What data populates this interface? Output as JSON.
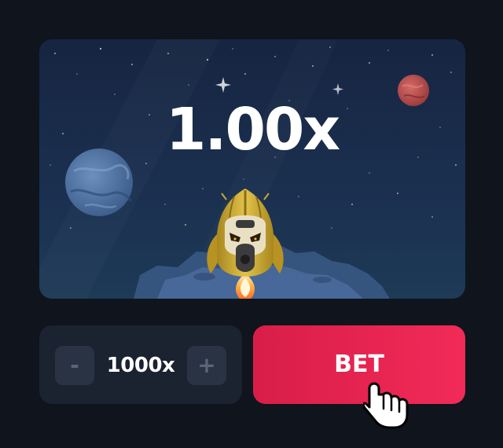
{
  "game": {
    "multiplier": "1.00x"
  },
  "controls": {
    "decrement_label": "-",
    "amount": "1000x",
    "increment_label": "+"
  },
  "bet": {
    "label": "BET"
  },
  "colors": {
    "background": "#0f141d",
    "stage_top": "#162541",
    "stage_bottom": "#1d3a57",
    "glow": "#1fb5a8",
    "rocket_gold": "#c9a532",
    "bet_button": "#ee2757",
    "control_panel": "#1b2230",
    "step_button": "#2a3343"
  },
  "icons": {
    "rocket": "rocket-icon",
    "cursor": "hand-pointer-icon",
    "planet_left": "blue-planet-icon",
    "planet_right": "red-planet-icon"
  }
}
